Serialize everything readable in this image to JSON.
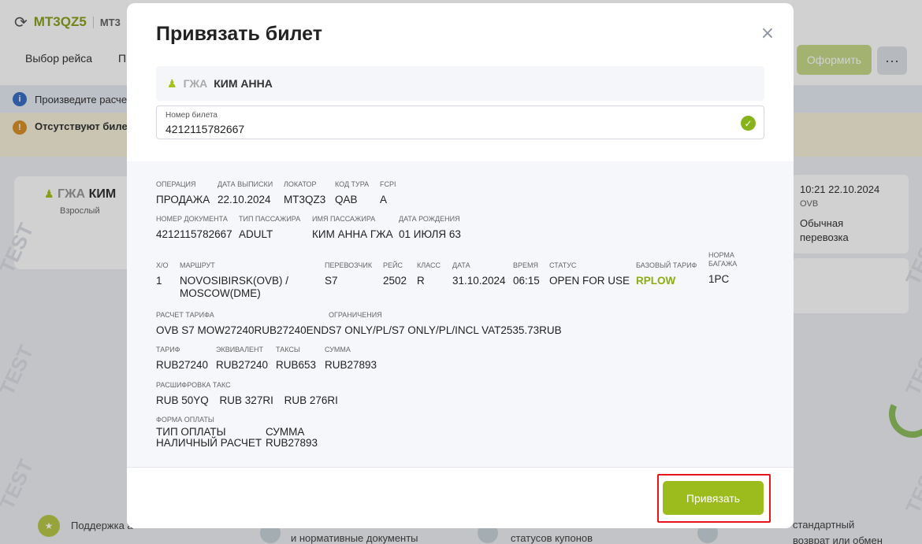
{
  "background": {
    "locator": "MT3QZ5",
    "locator2": "MT3",
    "tabs": [
      "Выбор рейса",
      "П"
    ],
    "order_button": "Оформить",
    "more_button": "···",
    "info_text": "Произведите расче",
    "warning_text": "Отсутствуют биле",
    "passenger_card": {
      "title": "ГЖА",
      "surname": "КИМ",
      "type": "Взрослый"
    },
    "right_card": {
      "time": "10:21 22.10.2024",
      "airport": "OVB",
      "type": "Обычная перевозка"
    },
    "footer": {
      "support": "Поддержка а",
      "docs": "и нормативные документы",
      "coupons": "статусов купонов",
      "exchange_line1": "стандартный",
      "exchange_line2": "возврат или обмен"
    },
    "watermark": "TEST"
  },
  "modal": {
    "title": "Привязать билет",
    "close_icon": "×",
    "passenger": {
      "title": "ГЖА",
      "name": "КИМ АННА"
    },
    "ticket_field": {
      "label": "Номер билета",
      "value": "4212115782667"
    },
    "details": {
      "operation": {
        "label": "Операция",
        "value": "ПРОДАЖА"
      },
      "issue_date": {
        "label": "Дата выписки",
        "value": "22.10.2024"
      },
      "locator": {
        "label": "Локатор",
        "value": "MT3QZ3"
      },
      "tour_code": {
        "label": "Код тура",
        "value": "QAB"
      },
      "fcpi": {
        "label": "FCPI",
        "value": "A"
      },
      "doc_number": {
        "label": "Номер документа",
        "value": "4212115782667"
      },
      "pax_type": {
        "label": "Тип пассажира",
        "value": "ADULT"
      },
      "pax_name": {
        "label": "Имя пассажира",
        "value": "КИМ АННА ГЖА"
      },
      "birth_date": {
        "label": "Дата рождения",
        "value": "01 ИЮЛЯ 63"
      },
      "segment": {
        "xo": {
          "label": "Х/О",
          "value": "1"
        },
        "route": {
          "label": "Маршрут",
          "value": "NOVOSIBIRSK(OVB) / MOSCOW(DME)"
        },
        "carrier": {
          "label": "Перевозчик",
          "value": "S7"
        },
        "flight": {
          "label": "Рейс",
          "value": "2502"
        },
        "class": {
          "label": "Класс",
          "value": "R"
        },
        "date": {
          "label": "Дата",
          "value": "31.10.2024"
        },
        "time": {
          "label": "Время",
          "value": "06:15"
        },
        "status": {
          "label": "Статус",
          "value": "OPEN FOR USE"
        },
        "base_fare": {
          "label": "Базовый тариф",
          "value": "RPLOW"
        },
        "baggage": {
          "label": "Норма багажа",
          "value": "1PC"
        }
      },
      "fare_calc": {
        "label": "Расчет тарифа",
        "value": "OVB S7 MOW27240RUB27240END"
      },
      "restrictions": {
        "label": "Ограничения",
        "value": "S7 ONLY/PL/S7 ONLY/PL/INCL VAT2535.73RUB"
      },
      "fare": {
        "label": "Тариф",
        "value": "RUB27240"
      },
      "equivalent": {
        "label": "Эквивалент",
        "value": "RUB27240"
      },
      "taxes": {
        "label": "Таксы",
        "value": "RUB653"
      },
      "total": {
        "label": "Сумма",
        "value": "RUB27893"
      },
      "tax_breakdown": {
        "label": "Расшифровка такс",
        "values": [
          "RUB 50YQ",
          "RUB 327RI",
          "RUB 276RI"
        ]
      },
      "payment": {
        "label": "Форма оплаты",
        "type_header": "ТИП ОПЛАТЫ",
        "sum_header": "СУММА",
        "type_value": "НАЛИЧНЫЙ РАСЧЕТ",
        "sum_value": "RUB27893"
      }
    },
    "attach_button": "Привязать"
  },
  "colors": {
    "accent_green": "#9cbb1d",
    "highlight_red": "#e8141c"
  }
}
